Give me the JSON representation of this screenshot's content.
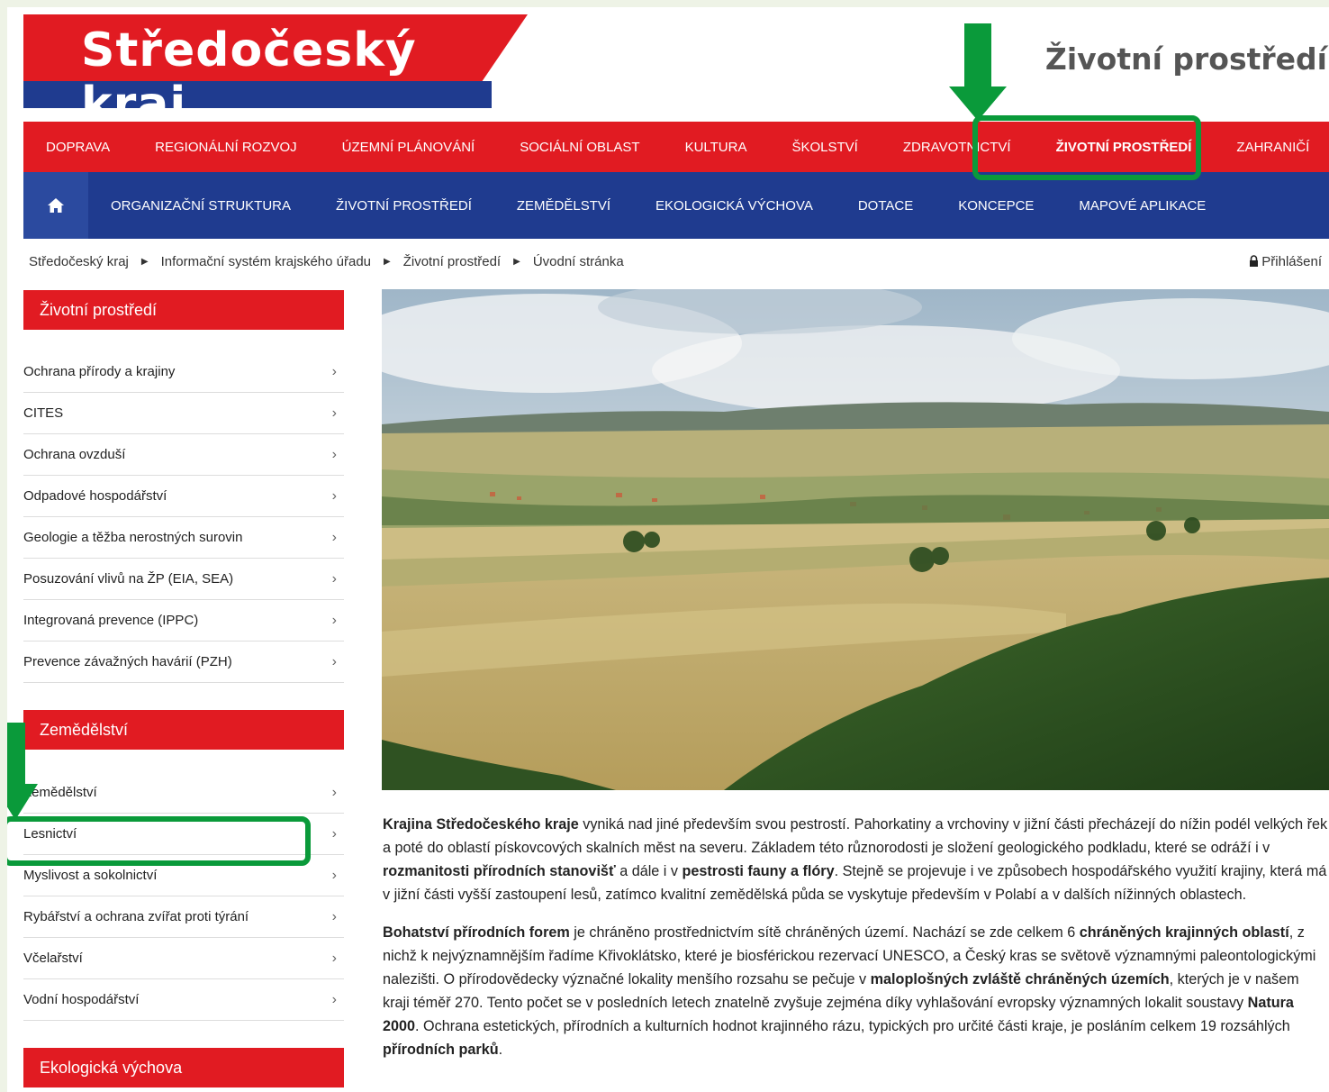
{
  "header": {
    "logo_text": "Středočeský kraj",
    "section_title": "Životní prostředí"
  },
  "nav_top": [
    "DOPRAVA",
    "REGIONÁLNÍ ROZVOJ",
    "ÚZEMNÍ PLÁNOVÁNÍ",
    "SOCIÁLNÍ OBLAST",
    "KULTURA",
    "ŠKOLSTVÍ",
    "ZDRAVOTNICTVÍ",
    "ŽIVOTNÍ PROSTŘEDÍ",
    "ZAHRANIČÍ"
  ],
  "nav_sub": [
    "ORGANIZAČNÍ STRUKTURA",
    "ŽIVOTNÍ PROSTŘEDÍ",
    "ZEMĚDĚLSTVÍ",
    "EKOLOGICKÁ VÝCHOVA",
    "DOTACE",
    "KONCEPCE",
    "MAPOVÉ APLIKACE"
  ],
  "breadcrumb": [
    "Středočeský kraj",
    "Informační systém krajského úřadu",
    "Životní prostředí",
    "Úvodní stránka"
  ],
  "login_label": "Přihlášení",
  "sidebar": {
    "env_heading": "Životní prostředí",
    "env_items": [
      "Ochrana přírody a krajiny",
      "CITES",
      "Ochrana ovzduší",
      "Odpadové hospodářství",
      "Geologie a těžba nerostných surovin",
      "Posuzování vlivů na ŽP (EIA, SEA)",
      "Integrovaná prevence (IPPC)",
      "Prevence závažných havárií (PZH)"
    ],
    "agri_heading": "Zemědělství",
    "agri_items": [
      "Zemědělství",
      "Lesnictví",
      "Myslivost a sokolnictví",
      "Rybářství a ochrana zvířat proti týrání",
      "Včelařství",
      "Vodní hospodářství"
    ],
    "eco_heading": "Ekologická výchova"
  },
  "content": {
    "p1": [
      {
        "b": true,
        "t": "Krajina Středočeského kraje"
      },
      {
        "b": false,
        "t": " vyniká nad jiné především svou pestrostí. Pahorkatiny a vrchoviny v jižní části přecházejí do nížin podél velkých řek a poté do oblastí pískovcových skalních měst na severu. Základem této různorodosti je složení geologického podkladu, které se odráží i v "
      },
      {
        "b": true,
        "t": "rozmanitosti přírodních stanovišť"
      },
      {
        "b": false,
        "t": " a dále i v "
      },
      {
        "b": true,
        "t": "pestrosti fauny a flóry"
      },
      {
        "b": false,
        "t": ". Stejně se projevuje i ve způsobech hospodářského využití krajiny, která má v jižní části vyšší zastoupení lesů, zatímco kvalitní zemědělská půda se vyskytuje především v Polabí a v dalších nížinných oblastech."
      }
    ],
    "p2": [
      {
        "b": true,
        "t": "Bohatství přírodních forem"
      },
      {
        "b": false,
        "t": " je chráněno prostřednictvím sítě chráněných území. Nachází se zde celkem 6 "
      },
      {
        "b": true,
        "t": "chráněných krajinných oblastí"
      },
      {
        "b": false,
        "t": ", z nichž k nejvýznamnějším řadíme Křivoklátsko, které je biosférickou rezervací UNESCO, a Český kras se světově významnými paleontologickými nalezišti. O přírodovědecky význačné lokality menšího rozsahu se pečuje v "
      },
      {
        "b": true,
        "t": "maloplošných zvláště chráněných územích"
      },
      {
        "b": false,
        "t": ", kterých je v našem kraji téměř 270. Tento počet se v posledních letech znatelně zvyšuje zejména díky vyhlašování evropsky významných lokalit soustavy "
      },
      {
        "b": true,
        "t": "Natura 2000"
      },
      {
        "b": false,
        "t": ". Ochrana estetických, přírodních a kulturních hodnot krajinného rázu, typických pro určité části kraje, je posláním celkem 19 rozsáhlých "
      },
      {
        "b": true,
        "t": "přírodních parků"
      },
      {
        "b": false,
        "t": "."
      }
    ]
  },
  "colors": {
    "red": "#e11b22",
    "blue": "#1f3b8f",
    "annotation_green": "#0a9a3a"
  }
}
